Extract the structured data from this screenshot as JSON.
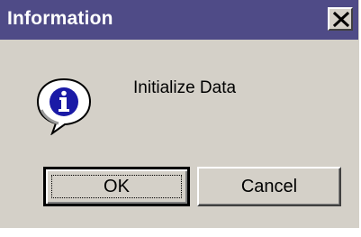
{
  "window": {
    "title": "Information"
  },
  "icon": {
    "name": "information-icon"
  },
  "message": "Initialize Data",
  "buttons": {
    "ok_label": "OK",
    "cancel_label": "Cancel"
  },
  "colors": {
    "titlebar": "#4f4b87",
    "dialog_face": "#d4d0c8",
    "icon_circle": "#1a1aa6"
  }
}
